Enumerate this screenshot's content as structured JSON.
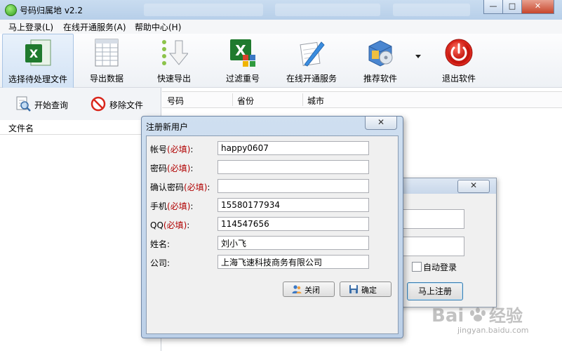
{
  "window": {
    "title": "号码归属地 v2.2",
    "controls": [
      "—",
      "□",
      "✕"
    ]
  },
  "menu": [
    {
      "label": "马上登录(L)"
    },
    {
      "label": "在线开通服务(A)"
    },
    {
      "label": "帮助中心(H)"
    }
  ],
  "toolbar": [
    {
      "label": "选择待处理文件",
      "icon": "excel-icon"
    },
    {
      "label": "导出数据",
      "icon": "spreadsheet-icon"
    },
    {
      "label": "快速导出",
      "icon": "quick-export-icon"
    },
    {
      "label": "过滤重号",
      "icon": "filter-excel-icon"
    },
    {
      "label": "在线开通服务",
      "icon": "notepad-pen-icon"
    },
    {
      "label": "推荐软件",
      "icon": "software-box-icon"
    },
    {
      "label": "退出软件",
      "icon": "power-icon"
    }
  ],
  "left_toolbar": {
    "query_label": "开始查询",
    "remove_label": "移除文件"
  },
  "file_list": {
    "header": "文件名"
  },
  "table": {
    "columns": [
      "号码",
      "省份",
      "城市"
    ]
  },
  "login_dialog": {
    "auto_login_label": "自动登录",
    "auto_login_checked": false,
    "submit_label": "马上注册"
  },
  "register_dialog": {
    "title": "注册新用户",
    "required_tag": "(必填)",
    "fields": [
      {
        "label": "帐号",
        "required": true,
        "value": "happy0607"
      },
      {
        "label": "密码",
        "required": true,
        "value": ""
      },
      {
        "label": "确认密码",
        "required": true,
        "value": ""
      },
      {
        "label": "手机",
        "required": true,
        "value": "15580177934"
      },
      {
        "label": "QQ",
        "required": true,
        "value": "114547656"
      },
      {
        "label": "姓名",
        "required": false,
        "value": "刘小飞"
      },
      {
        "label": "公司",
        "required": false,
        "value": "上海飞速科技商务有限公司"
      }
    ],
    "colon": ":",
    "close_label": "关闭",
    "ok_label": "确定"
  },
  "watermark": {
    "line1": "Bai",
    "line1b": "经验",
    "line2": "jingyan.baidu.com"
  }
}
